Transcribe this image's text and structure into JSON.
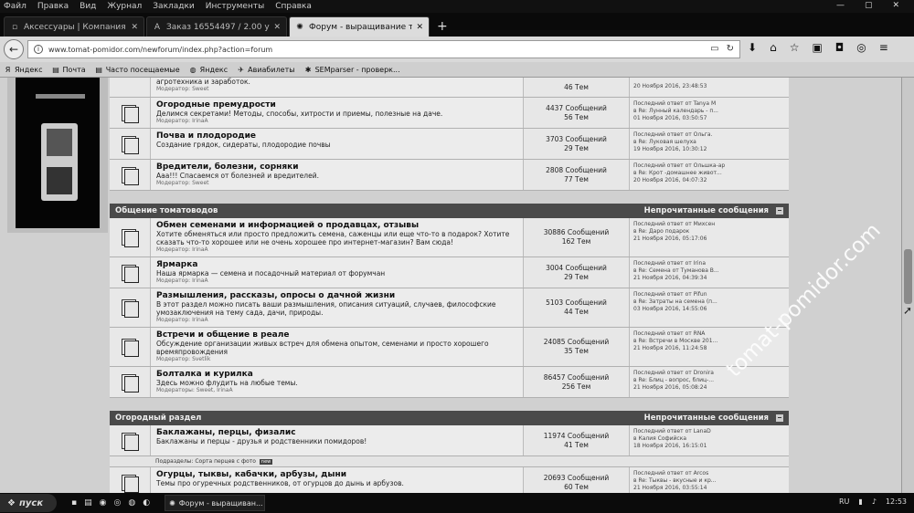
{
  "menu": [
    "Файл",
    "Правка",
    "Вид",
    "Журнал",
    "Закладки",
    "Инструменты",
    "Справка"
  ],
  "window_controls": [
    "—",
    "▢",
    "✕"
  ],
  "tabs": [
    {
      "label": "Аксессуары | Компания Wa...",
      "icon": "page-icon",
      "close": "✕"
    },
    {
      "label": "Заказ 16554497 / 2.00 у.е. / ...",
      "icon": "letter-a-icon",
      "close": "✕"
    },
    {
      "label": "Форум - выращивание тома...",
      "icon": "gear-icon",
      "close": "✕"
    }
  ],
  "newtab_label": "+",
  "address": {
    "url": "www.tomat-pomidor.com/newforum/index.php?action=forum"
  },
  "bookmarks": [
    {
      "label": "Яндекс"
    },
    {
      "label": "Почта"
    },
    {
      "label": "Часто посещаемые"
    },
    {
      "label": "Яндекс"
    },
    {
      "label": "Авиабилеты"
    },
    {
      "label": "SEMparser - проверк..."
    }
  ],
  "sections_top": [
    {
      "title": "",
      "desc": "агротехника и заработок.",
      "mod": "Модератор: Sweet",
      "stats1": "",
      "stats2": "46 Тем",
      "last": [
        "",
        "",
        "20 Ноября 2016, 23:48:53"
      ]
    },
    {
      "title": "Огородные премудрости",
      "desc": "Делимся секретами! Методы, способы, хитрости и приемы, полезные на даче.",
      "mod": "Модератор: IrinaA",
      "stats1": "4437 Сообщений",
      "stats2": "56 Тем",
      "last": [
        "Последний ответ от Tanya M",
        "в Re: Лунный календарь - п...",
        "01 Ноября 2016, 03:50:57"
      ]
    },
    {
      "title": "Почва и плодородие",
      "desc": "Создание грядок, сидераты, плодородие почвы",
      "mod": "",
      "stats1": "3703 Сообщений",
      "stats2": "29 Тем",
      "last": [
        "Последний ответ от Ольга.",
        "в Re: Луковая шелуха",
        "19 Ноября 2016, 10:30:12"
      ]
    },
    {
      "title": "Вредители, болезни, сорняки",
      "desc": "Ааа!!! Спасаемся от болезней и вредителей.",
      "mod": "Модератор: Sweet",
      "stats1": "2808 Сообщений",
      "stats2": "77 Тем",
      "last": [
        "Последний ответ от Ольшка-ар",
        "в Re: Крот -домашнее живот...",
        "20 Ноября 2016, 04:07:32"
      ]
    }
  ],
  "cat1": {
    "title": "Общение томатоводов",
    "unread": "Непрочитанные сообщения"
  },
  "sections_mid": [
    {
      "title": "Обмен семенами и информацией о продавцах, отзывы",
      "desc": "Хотите обменяться или просто предложить семена, саженцы или еще что-то в подарок? Хотите сказать что-то хорошее или не очень хорошее про интернет-магазин? Вам сюда!",
      "mod": "Модератор: IrinaA",
      "stats1": "30886 Сообщений",
      "stats2": "162 Тем",
      "last": [
        "Последний ответ от Михсен",
        "в Re: Даро подарок",
        "21 Ноября 2016, 05:17:06"
      ]
    },
    {
      "title": "Ярмарка",
      "desc": "Наша ярмарка — семена и посадочный материал от форумчан",
      "mod": "Модератор: IrinaA",
      "stats1": "3004 Сообщений",
      "stats2": "29 Тем",
      "last": [
        "Последний ответ от Irina",
        "в Re: Семена от Тумановa В...",
        "21 Ноября 2016, 04:39:34"
      ]
    },
    {
      "title": "Размышления, рассказы, опросы о дачной жизни",
      "desc": "В этот раздел можно писать ваши размышления, описания ситуаций, случаев, философские умозаключения на тему сада, дачи, природы.",
      "mod": "Модератор: IrinaA",
      "stats1": "5103 Сообщений",
      "stats2": "44 Тем",
      "last": [
        "Последний ответ от Pifun",
        "в Re: Затраты на семена (п...",
        "03 Ноября 2016, 14:55:06"
      ]
    },
    {
      "title": "Встречи и общение в реале",
      "desc": "Обсуждение организации живых встреч для обмена опытом, семенами и просто хорошего времяпровождения",
      "mod": "Модератор: Svetlik",
      "stats1": "24085 Сообщений",
      "stats2": "35 Тем",
      "last": [
        "Последний ответ от RNA",
        "в Re: Встречи в Москве 201...",
        "21 Ноября 2016, 11:24:58"
      ]
    },
    {
      "title": "Болталка и курилка",
      "desc": "Здесь можно флудить на любые темы.",
      "mod": "Модераторы: Sweet, IrinaA",
      "stats1": "86457 Сообщений",
      "stats2": "256 Тем",
      "last": [
        "Последний ответ от Dronira",
        "в Re: Блиц - вопрос, блиц-...",
        "21 Ноября 2016, 05:08:24"
      ]
    }
  ],
  "cat2": {
    "title": "Огородный раздел",
    "unread": "Непрочитанные сообщения"
  },
  "sections_bottom": [
    {
      "title": "Баклажаны, перцы, физалис",
      "desc": "Баклажаны и перцы - друзья и родственники помидоров!",
      "mod": "",
      "stats1": "11974 Сообщений",
      "stats2": "41 Тем",
      "last": [
        "Последний ответ от LanaD",
        "в Калия Софийска",
        "18 Ноября 2016, 16:15:01"
      ]
    },
    {
      "title": "Огурцы, тыквы, кабачки, арбузы, дыни",
      "desc": "Темы про огуречных родственников, от огурцов до дынь и арбузов.",
      "mod": "",
      "stats1": "20693 Сообщений",
      "stats2": "60 Тем",
      "last": [
        "Последний ответ от Arcos",
        "в Re: Тыквы - вкусные и кр...",
        "21 Ноября 2016, 03:55:14"
      ]
    }
  ],
  "subforums": {
    "label": "Подразделы: Сорта перцев с фото",
    "tag": "new"
  },
  "taskbar": {
    "start": "пуск",
    "item": "Форум - выращиван...",
    "lang": "RU",
    "time": "12:53"
  },
  "watermark": "tomat-pomidor.com"
}
